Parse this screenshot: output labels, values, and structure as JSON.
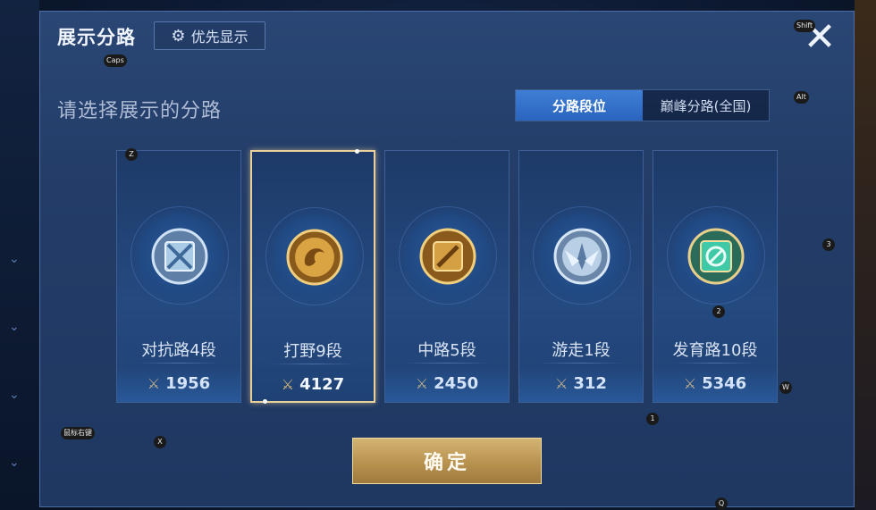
{
  "header": {
    "title": "展示分路",
    "priority_label": "优先显示"
  },
  "subtitle": "请选择展示的分路",
  "tabs": [
    {
      "label": "分路段位",
      "active": true
    },
    {
      "label": "巅峰分路(全国)",
      "active": false
    }
  ],
  "cards": [
    {
      "name": "对抗路4段",
      "score": "1956",
      "emblem": "shield-crossed-swords",
      "color": "#9fc4e0",
      "selected": false
    },
    {
      "name": "打野9段",
      "score": "4127",
      "emblem": "gold-dragon",
      "color": "#d9a441",
      "selected": true
    },
    {
      "name": "中路5段",
      "score": "2450",
      "emblem": "gold-slash-square",
      "color": "#d4a043",
      "selected": false
    },
    {
      "name": "游走1段",
      "score": "312",
      "emblem": "silver-wings",
      "color": "#b8cfe6",
      "selected": false
    },
    {
      "name": "发育路10段",
      "score": "5346",
      "emblem": "jade-target",
      "color": "#3fc9a6",
      "selected": false
    }
  ],
  "confirm_label": "确定",
  "key_hints": {
    "caps": "Caps",
    "shift": "Shift",
    "alt": "Alt",
    "z": "Z",
    "three": "3",
    "two": "2",
    "w": "W",
    "one": "1",
    "x": "X",
    "mouse_right": "鼠标右键",
    "q": "Q"
  }
}
